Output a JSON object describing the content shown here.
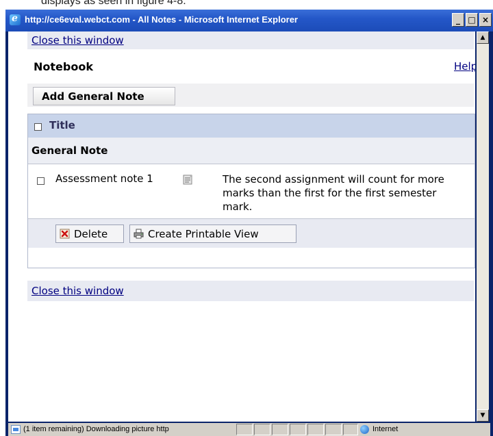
{
  "caption": "displays as seen in figure 4-8.",
  "window": {
    "title": "http://ce6eval.webct.com - All Notes - Microsoft Internet Explorer",
    "buttons": {
      "minimize": "_",
      "maximize": "□",
      "close": "×"
    }
  },
  "page": {
    "close_top": "Close this window",
    "notebook_title": "Notebook",
    "help": "Help",
    "add_note_button": "Add General Note",
    "table": {
      "header": "Title",
      "group": "General Note",
      "notes": [
        {
          "title": "Assessment note 1",
          "text": "The second assignment will count for more marks than the first for the first semester mark."
        }
      ]
    },
    "delete_button": "Delete",
    "print_button": "Create Printable View",
    "close_bottom": "Close this window"
  },
  "status": {
    "text": "(1 item remaining) Downloading picture http",
    "zone": "Internet"
  },
  "colors": {
    "title_bar": "#2457c8",
    "link": "#000080",
    "header_row": "#c8d4ea"
  }
}
